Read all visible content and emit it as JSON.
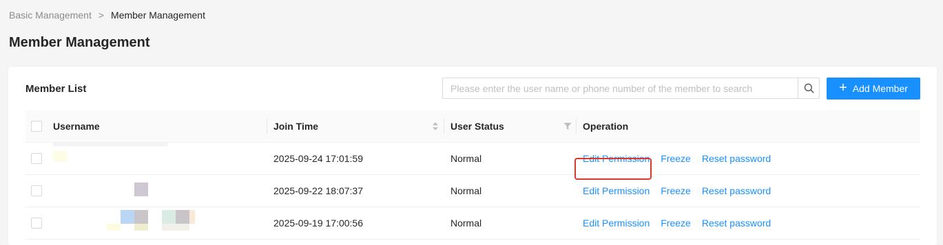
{
  "breadcrumb": {
    "parent": "Basic Management",
    "separator": ">",
    "current": "Member Management"
  },
  "page_title": "Member Management",
  "card": {
    "title": "Member List",
    "search": {
      "placeholder": "Please enter the user name or phone number of the member to search",
      "value": ""
    },
    "add_button": "Add Member"
  },
  "table": {
    "columns": {
      "username": "Username",
      "join_time": "Join Time",
      "user_status": "User Status",
      "operation": "Operation"
    },
    "rows": [
      {
        "username": "",
        "join_time": "2025-09-24 17:01:59",
        "status": "Normal",
        "ops": {
          "edit": "Edit Permission",
          "freeze": "Freeze",
          "reset": "Reset password"
        }
      },
      {
        "username": "",
        "join_time": "2025-09-22 18:07:37",
        "status": "Normal",
        "ops": {
          "edit": "Edit Permission",
          "freeze": "Freeze",
          "reset": "Reset password"
        }
      },
      {
        "username": "",
        "join_time": "2025-09-19 17:00:56",
        "status": "Normal",
        "ops": {
          "edit": "Edit Permission",
          "freeze": "Freeze",
          "reset": "Reset password"
        }
      }
    ]
  },
  "colors": {
    "primary": "#1890ff",
    "highlight": "#d9382e"
  }
}
